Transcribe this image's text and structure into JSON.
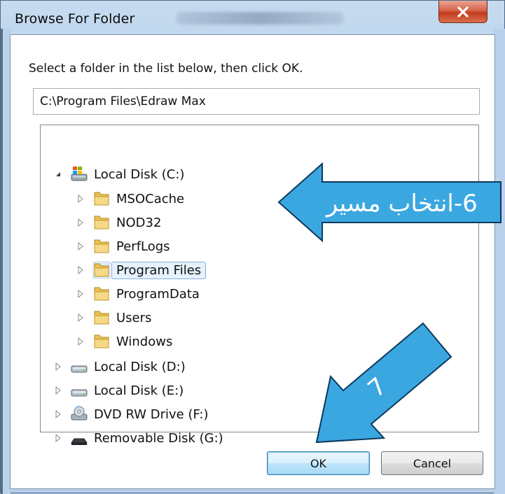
{
  "window": {
    "title": "Browse For Folder",
    "close_label": "x"
  },
  "dialog": {
    "instruction": "Select a folder in the list below, then click OK.",
    "path_value": "C:\\Program Files\\Edraw Max"
  },
  "tree": {
    "items": [
      {
        "label": "Local Disk (C:)",
        "icon": "hard-drive-icon",
        "expanded": true
      },
      {
        "label": "MSOCache",
        "icon": "folder-icon"
      },
      {
        "label": "NOD32",
        "icon": "folder-icon"
      },
      {
        "label": "PerfLogs",
        "icon": "folder-icon"
      },
      {
        "label": "Program Files",
        "icon": "folder-icon",
        "selected": true
      },
      {
        "label": "ProgramData",
        "icon": "folder-icon"
      },
      {
        "label": "Users",
        "icon": "folder-icon"
      },
      {
        "label": "Windows",
        "icon": "folder-icon"
      },
      {
        "label": "Local Disk (D:)",
        "icon": "drive-icon"
      },
      {
        "label": "Local Disk (E:)",
        "icon": "drive-icon"
      },
      {
        "label": "DVD RW Drive (F:)",
        "icon": "dvd-drive-icon"
      },
      {
        "label": "Removable Disk (G:)",
        "icon": "removable-drive-icon"
      }
    ]
  },
  "buttons": {
    "ok": "OK",
    "cancel": "Cancel"
  },
  "annotations": {
    "step6_text": "6-انتخاب مسیر",
    "step7_text": "7",
    "arrow_color": "#3ba7e0",
    "arrow_border": "#0a3a5c"
  }
}
